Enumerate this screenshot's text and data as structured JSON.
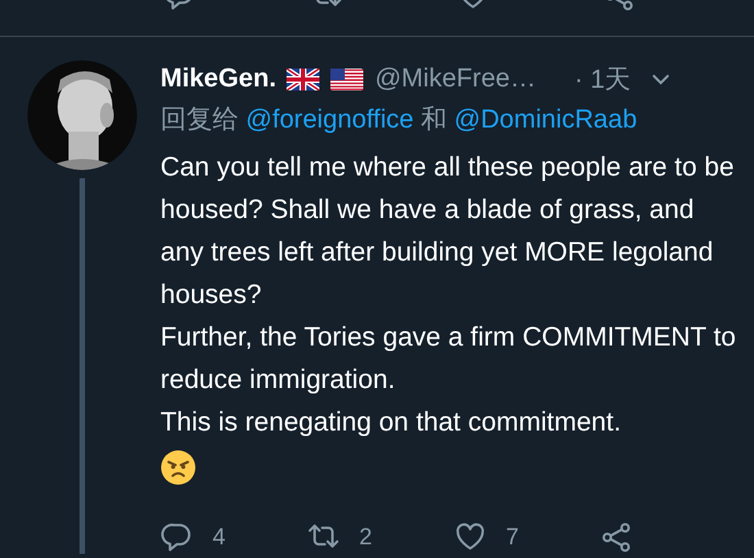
{
  "previous_actions": [
    {
      "kind": "reply"
    },
    {
      "kind": "retweet"
    },
    {
      "kind": "like"
    },
    {
      "kind": "share"
    }
  ],
  "tweet": {
    "avatar": {
      "kind": "picture"
    },
    "name": "MikeGen.",
    "flags": [
      {
        "kind": "uk"
      },
      {
        "kind": "us"
      }
    ],
    "handle": "@MikeFree…",
    "time": "· 1天",
    "reply_to": [
      {
        "kind": "text",
        "text": "回复给"
      },
      {
        "kind": "mention",
        "text": "@foreignoffice"
      },
      {
        "kind": "text",
        "text": "和"
      },
      {
        "kind": "mention",
        "text": "@DominicRaab"
      }
    ],
    "body": [
      "Can you tell me where all these people are to be housed? Shall we have a blade of grass, and any trees left after building yet MORE legoland houses?",
      "Further, the Tories gave a firm COMMITMENT to reduce immigration.",
      "This is renegating on that commitment."
    ],
    "emoji": {
      "kind": "angry"
    },
    "actions": [
      {
        "kind": "reply",
        "count": "4"
      },
      {
        "kind": "retweet",
        "count": "2"
      },
      {
        "kind": "like",
        "count": "7"
      },
      {
        "kind": "share"
      }
    ]
  }
}
